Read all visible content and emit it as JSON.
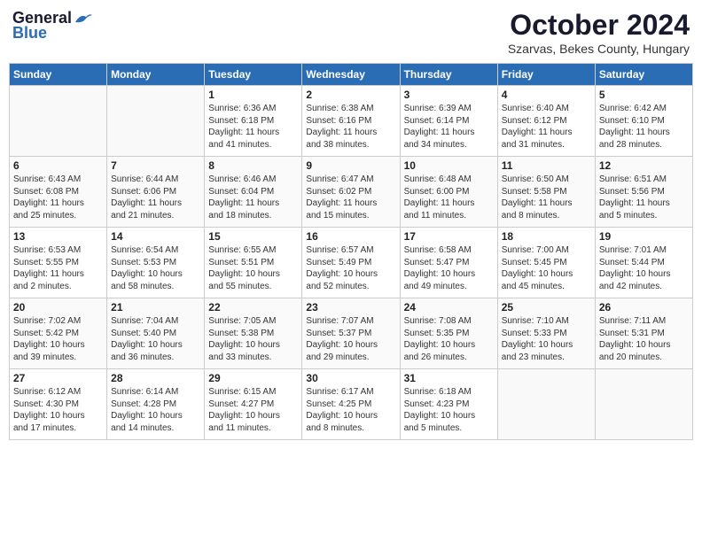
{
  "header": {
    "logo_general": "General",
    "logo_blue": "Blue",
    "month_title": "October 2024",
    "location": "Szarvas, Bekes County, Hungary"
  },
  "days_of_week": [
    "Sunday",
    "Monday",
    "Tuesday",
    "Wednesday",
    "Thursday",
    "Friday",
    "Saturday"
  ],
  "weeks": [
    [
      {
        "day": "",
        "details": ""
      },
      {
        "day": "",
        "details": ""
      },
      {
        "day": "1",
        "details": "Sunrise: 6:36 AM\nSunset: 6:18 PM\nDaylight: 11 hours\nand 41 minutes."
      },
      {
        "day": "2",
        "details": "Sunrise: 6:38 AM\nSunset: 6:16 PM\nDaylight: 11 hours\nand 38 minutes."
      },
      {
        "day": "3",
        "details": "Sunrise: 6:39 AM\nSunset: 6:14 PM\nDaylight: 11 hours\nand 34 minutes."
      },
      {
        "day": "4",
        "details": "Sunrise: 6:40 AM\nSunset: 6:12 PM\nDaylight: 11 hours\nand 31 minutes."
      },
      {
        "day": "5",
        "details": "Sunrise: 6:42 AM\nSunset: 6:10 PM\nDaylight: 11 hours\nand 28 minutes."
      }
    ],
    [
      {
        "day": "6",
        "details": "Sunrise: 6:43 AM\nSunset: 6:08 PM\nDaylight: 11 hours\nand 25 minutes."
      },
      {
        "day": "7",
        "details": "Sunrise: 6:44 AM\nSunset: 6:06 PM\nDaylight: 11 hours\nand 21 minutes."
      },
      {
        "day": "8",
        "details": "Sunrise: 6:46 AM\nSunset: 6:04 PM\nDaylight: 11 hours\nand 18 minutes."
      },
      {
        "day": "9",
        "details": "Sunrise: 6:47 AM\nSunset: 6:02 PM\nDaylight: 11 hours\nand 15 minutes."
      },
      {
        "day": "10",
        "details": "Sunrise: 6:48 AM\nSunset: 6:00 PM\nDaylight: 11 hours\nand 11 minutes."
      },
      {
        "day": "11",
        "details": "Sunrise: 6:50 AM\nSunset: 5:58 PM\nDaylight: 11 hours\nand 8 minutes."
      },
      {
        "day": "12",
        "details": "Sunrise: 6:51 AM\nSunset: 5:56 PM\nDaylight: 11 hours\nand 5 minutes."
      }
    ],
    [
      {
        "day": "13",
        "details": "Sunrise: 6:53 AM\nSunset: 5:55 PM\nDaylight: 11 hours\nand 2 minutes."
      },
      {
        "day": "14",
        "details": "Sunrise: 6:54 AM\nSunset: 5:53 PM\nDaylight: 10 hours\nand 58 minutes."
      },
      {
        "day": "15",
        "details": "Sunrise: 6:55 AM\nSunset: 5:51 PM\nDaylight: 10 hours\nand 55 minutes."
      },
      {
        "day": "16",
        "details": "Sunrise: 6:57 AM\nSunset: 5:49 PM\nDaylight: 10 hours\nand 52 minutes."
      },
      {
        "day": "17",
        "details": "Sunrise: 6:58 AM\nSunset: 5:47 PM\nDaylight: 10 hours\nand 49 minutes."
      },
      {
        "day": "18",
        "details": "Sunrise: 7:00 AM\nSunset: 5:45 PM\nDaylight: 10 hours\nand 45 minutes."
      },
      {
        "day": "19",
        "details": "Sunrise: 7:01 AM\nSunset: 5:44 PM\nDaylight: 10 hours\nand 42 minutes."
      }
    ],
    [
      {
        "day": "20",
        "details": "Sunrise: 7:02 AM\nSunset: 5:42 PM\nDaylight: 10 hours\nand 39 minutes."
      },
      {
        "day": "21",
        "details": "Sunrise: 7:04 AM\nSunset: 5:40 PM\nDaylight: 10 hours\nand 36 minutes."
      },
      {
        "day": "22",
        "details": "Sunrise: 7:05 AM\nSunset: 5:38 PM\nDaylight: 10 hours\nand 33 minutes."
      },
      {
        "day": "23",
        "details": "Sunrise: 7:07 AM\nSunset: 5:37 PM\nDaylight: 10 hours\nand 29 minutes."
      },
      {
        "day": "24",
        "details": "Sunrise: 7:08 AM\nSunset: 5:35 PM\nDaylight: 10 hours\nand 26 minutes."
      },
      {
        "day": "25",
        "details": "Sunrise: 7:10 AM\nSunset: 5:33 PM\nDaylight: 10 hours\nand 23 minutes."
      },
      {
        "day": "26",
        "details": "Sunrise: 7:11 AM\nSunset: 5:31 PM\nDaylight: 10 hours\nand 20 minutes."
      }
    ],
    [
      {
        "day": "27",
        "details": "Sunrise: 6:12 AM\nSunset: 4:30 PM\nDaylight: 10 hours\nand 17 minutes."
      },
      {
        "day": "28",
        "details": "Sunrise: 6:14 AM\nSunset: 4:28 PM\nDaylight: 10 hours\nand 14 minutes."
      },
      {
        "day": "29",
        "details": "Sunrise: 6:15 AM\nSunset: 4:27 PM\nDaylight: 10 hours\nand 11 minutes."
      },
      {
        "day": "30",
        "details": "Sunrise: 6:17 AM\nSunset: 4:25 PM\nDaylight: 10 hours\nand 8 minutes."
      },
      {
        "day": "31",
        "details": "Sunrise: 6:18 AM\nSunset: 4:23 PM\nDaylight: 10 hours\nand 5 minutes."
      },
      {
        "day": "",
        "details": ""
      },
      {
        "day": "",
        "details": ""
      }
    ]
  ]
}
